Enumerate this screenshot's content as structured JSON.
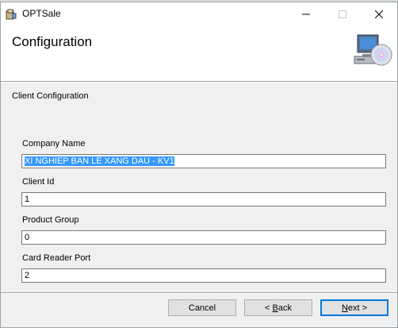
{
  "window": {
    "title": "OPTSale"
  },
  "header": {
    "title": "Configuration"
  },
  "section": {
    "label": "Client Configuration"
  },
  "fields": {
    "company_name": {
      "label": "Company Name",
      "value": "XI NGHIEP BAN LE XANG DAU - KV1"
    },
    "client_id": {
      "label": "Client Id",
      "value": "1"
    },
    "product_group": {
      "label": "Product Group",
      "value": "0"
    },
    "card_reader_port": {
      "label": "Card Reader Port",
      "value": "2"
    }
  },
  "buttons": {
    "cancel": "Cancel",
    "back_prefix": "< ",
    "back_hotkey": "B",
    "back_rest": "ack",
    "next_hotkey": "N",
    "next_rest": "ext >"
  },
  "icons": {
    "app": "setup-app-icon",
    "header": "computer-cd-icon",
    "minimize": "minimize-icon",
    "maximize": "maximize-icon",
    "close": "close-icon"
  },
  "colors": {
    "selection": "#3399ff",
    "default_button_border": "#0078d7"
  }
}
